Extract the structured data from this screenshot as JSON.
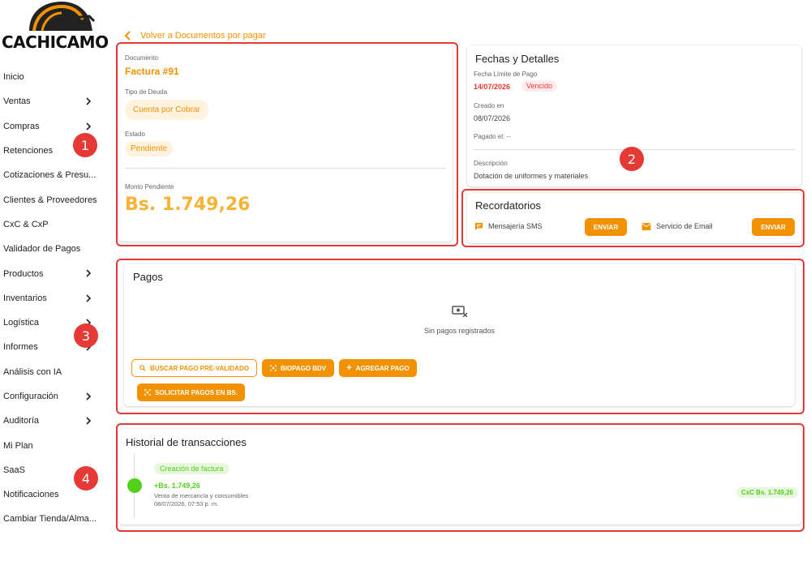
{
  "brand": {
    "name": "CACHICAMO"
  },
  "sidebar": {
    "items": [
      {
        "label": "Inicio",
        "chevron": false
      },
      {
        "label": "Ventas",
        "chevron": true
      },
      {
        "label": "Compras",
        "chevron": true
      },
      {
        "label": "Retenciones",
        "chevron": false
      },
      {
        "label": "Cotizaciones & Presu...",
        "chevron": false
      },
      {
        "label": "Clientes & Proveedores",
        "chevron": false
      },
      {
        "label": "CxC & CxP",
        "chevron": false
      },
      {
        "label": "Validador de Pagos",
        "chevron": false
      },
      {
        "label": "Productos",
        "chevron": true
      },
      {
        "label": "Inventarios",
        "chevron": true
      },
      {
        "label": "Logística",
        "chevron": true
      },
      {
        "label": "Informes",
        "chevron": true
      },
      {
        "label": "Análisis con IA",
        "chevron": false
      },
      {
        "label": "Configuración",
        "chevron": true
      },
      {
        "label": "Auditoría",
        "chevron": true
      },
      {
        "label": "Mi Plan",
        "chevron": false
      },
      {
        "label": "SaaS",
        "chevron": false
      },
      {
        "label": "Notificaciones",
        "chevron": false
      },
      {
        "label": "Cambiar Tienda/Alma...",
        "chevron": false
      }
    ]
  },
  "back_link": "Volver a Documentos por pagar",
  "document": {
    "doc_label": "Documento",
    "doc_title": "Factura #91",
    "debt_label": "Tipo de Deuda",
    "debt_type": "Cuenta por Cobrar",
    "state_label": "Estado",
    "state": "Pendiente",
    "amount_label": "Monto Pendiente",
    "amount": "Bs. 1.749,26"
  },
  "details": {
    "title": "Fechas y Detalles",
    "due_label": "Fecha Límite de Pago",
    "due_date": "14/07/2026",
    "due_badge": "Vencido",
    "created_label": "Creado en",
    "created_date": "08/07/2026",
    "paid_label": "Pagado el: --",
    "desc_label": "Descripción",
    "desc": "Dotación de uniformes y materiales"
  },
  "reminders": {
    "title": "Recordatorios",
    "sms_label": "Mensajería SMS",
    "email_label": "Servicio de Email",
    "send_label": "ENVIAR"
  },
  "payments": {
    "title": "Pagos",
    "empty": "Sin pagos registrados",
    "btn_search": "BUSCAR PAGO PRE-VALIDADO",
    "btn_biopago": "BIOPAGO BDV",
    "btn_add": "AGREGAR PAGO",
    "btn_request": "SOLICITAR PAGOS EN BS."
  },
  "history": {
    "title": "Historial de transacciones",
    "event_tag": "Creación de factura",
    "event_amount": "+Bs. 1.749,26",
    "event_desc": "Venta de mercancía y consumibles",
    "event_date": "08/07/2026, 07:53 p. m.",
    "event_badge": "CxC Bs. 1.749,26"
  },
  "markers": [
    "1",
    "2",
    "3",
    "4"
  ],
  "colors": {
    "accent": "#f39200",
    "amount": "#f9b233",
    "danger": "#e53935",
    "success": "#52d11a"
  }
}
